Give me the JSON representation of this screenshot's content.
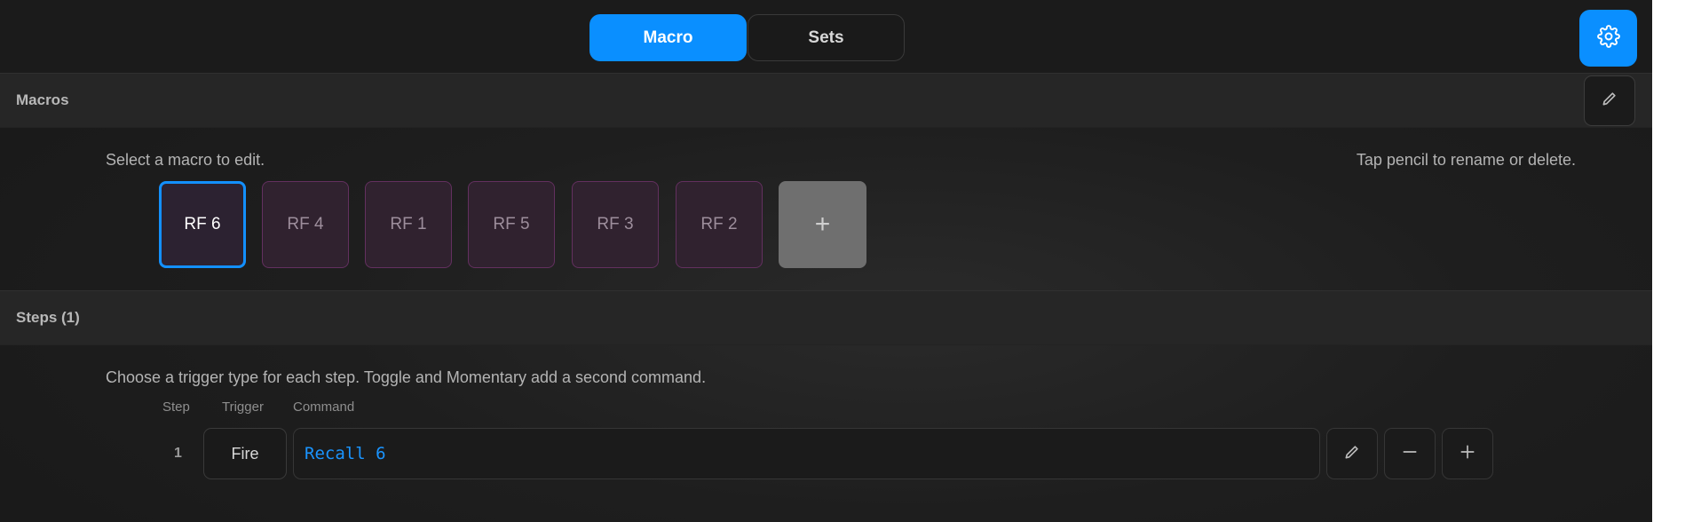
{
  "tabs": [
    {
      "label": "Macro",
      "active": true
    },
    {
      "label": "Sets",
      "active": false
    }
  ],
  "toolbar": {
    "settings_icon": "gear-icon"
  },
  "macros": {
    "title": "Macros",
    "edit_icon": "pencil-icon",
    "hint_left": "Select a macro to edit.",
    "hint_right": "Tap pencil to rename or delete.",
    "items": [
      {
        "label": "RF 6",
        "selected": true
      },
      {
        "label": "RF 4",
        "selected": false
      },
      {
        "label": "RF 1",
        "selected": false
      },
      {
        "label": "RF 5",
        "selected": false
      },
      {
        "label": "RF 3",
        "selected": false
      },
      {
        "label": "RF 2",
        "selected": false
      }
    ],
    "add_label": "+"
  },
  "steps": {
    "title": "Steps (1)",
    "hint": "Choose a trigger type for each step. Toggle and Momentary add a second command.",
    "columns": [
      "Step",
      "Trigger",
      "Command"
    ],
    "rows": [
      {
        "step": "1",
        "trigger": "Fire",
        "command": "Recall 6"
      }
    ]
  },
  "colors": {
    "accent": "#0a8fff",
    "command_text": "#1a94ff",
    "macro_tile_bg": "#30222f",
    "macro_tile_border": "#63305f"
  }
}
